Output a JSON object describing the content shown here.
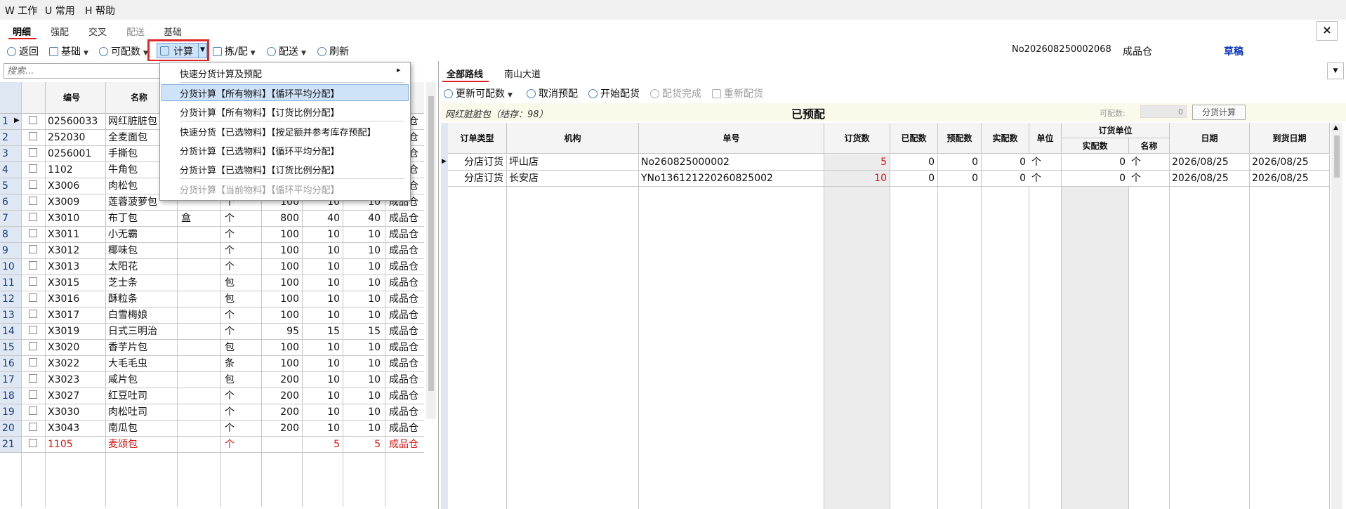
{
  "menubar": {
    "work": "W 工作",
    "common": "U 常用",
    "help": "H 帮助"
  },
  "tabs": [
    "明细",
    "强配",
    "交叉",
    "配送",
    "基础"
  ],
  "close_label": "×",
  "toolbar": {
    "back": "返回",
    "base": "基础",
    "available": "可配数",
    "calculate": "计算",
    "pick": "拣/配",
    "deliver": "配送",
    "refresh": "刷新",
    "doc_no": "No202608250002068",
    "warehouse": "成品仓",
    "status": "草稿"
  },
  "search": {
    "placeholder": "搜索..."
  },
  "left_grid": {
    "headers": {
      "code": "编号",
      "name": "名称"
    },
    "rows": [
      {
        "n": "1",
        "code": "02560033",
        "name": "网红脏脏包",
        "unit2": "",
        "unit": "",
        "a": "",
        "b": "",
        "c": "",
        "wh": "成品仓"
      },
      {
        "n": "2",
        "code": "252030",
        "name": "全麦面包",
        "unit2": "",
        "unit": "",
        "a": "",
        "b": "",
        "c": "",
        "wh": "成品仓"
      },
      {
        "n": "3",
        "code": "0256001",
        "name": "手撕包",
        "unit2": "",
        "unit": "",
        "a": "",
        "b": "",
        "c": "",
        "wh": "成品仓"
      },
      {
        "n": "4",
        "code": "1102",
        "name": "牛角包",
        "unit2": "",
        "unit": "",
        "a": "",
        "b": "",
        "c": "",
        "wh": "成品仓"
      },
      {
        "n": "5",
        "code": "X3006",
        "name": "肉松包",
        "unit2": "",
        "unit": "",
        "a": "",
        "b": "",
        "c": "",
        "wh": "成品仓"
      },
      {
        "n": "6",
        "code": "X3009",
        "name": "莲蓉菠萝包",
        "unit2": "",
        "unit": "个",
        "a": "100",
        "b": "10",
        "c": "10",
        "wh": "成品仓"
      },
      {
        "n": "7",
        "code": "X3010",
        "name": "布丁包",
        "unit2": "盒",
        "unit": "个",
        "a": "800",
        "b": "40",
        "c": "40",
        "wh": "成品仓"
      },
      {
        "n": "8",
        "code": "X3011",
        "name": "小无霸",
        "unit2": "",
        "unit": "个",
        "a": "100",
        "b": "10",
        "c": "10",
        "wh": "成品仓"
      },
      {
        "n": "9",
        "code": "X3012",
        "name": "椰味包",
        "unit2": "",
        "unit": "个",
        "a": "100",
        "b": "10",
        "c": "10",
        "wh": "成品仓"
      },
      {
        "n": "10",
        "code": "X3013",
        "name": "太阳花",
        "unit2": "",
        "unit": "个",
        "a": "100",
        "b": "10",
        "c": "10",
        "wh": "成品仓"
      },
      {
        "n": "11",
        "code": "X3015",
        "name": "芝士条",
        "unit2": "",
        "unit": "包",
        "a": "100",
        "b": "10",
        "c": "10",
        "wh": "成品仓"
      },
      {
        "n": "12",
        "code": "X3016",
        "name": "酥粒条",
        "unit2": "",
        "unit": "包",
        "a": "100",
        "b": "10",
        "c": "10",
        "wh": "成品仓"
      },
      {
        "n": "13",
        "code": "X3017",
        "name": "白雪梅娘",
        "unit2": "",
        "unit": "个",
        "a": "100",
        "b": "10",
        "c": "10",
        "wh": "成品仓"
      },
      {
        "n": "14",
        "code": "X3019",
        "name": "日式三明治",
        "unit2": "",
        "unit": "个",
        "a": "95",
        "b": "15",
        "c": "15",
        "wh": "成品仓"
      },
      {
        "n": "15",
        "code": "X3020",
        "name": "香芋片包",
        "unit2": "",
        "unit": "包",
        "a": "100",
        "b": "10",
        "c": "10",
        "wh": "成品仓"
      },
      {
        "n": "16",
        "code": "X3022",
        "name": "大毛毛虫",
        "unit2": "",
        "unit": "条",
        "a": "100",
        "b": "10",
        "c": "10",
        "wh": "成品仓"
      },
      {
        "n": "17",
        "code": "X3023",
        "name": "咸片包",
        "unit2": "",
        "unit": "包",
        "a": "200",
        "b": "10",
        "c": "10",
        "wh": "成品仓"
      },
      {
        "n": "18",
        "code": "X3027",
        "name": "红豆吐司",
        "unit2": "",
        "unit": "个",
        "a": "200",
        "b": "10",
        "c": "10",
        "wh": "成品仓"
      },
      {
        "n": "19",
        "code": "X3030",
        "name": "肉松吐司",
        "unit2": "",
        "unit": "个",
        "a": "200",
        "b": "10",
        "c": "10",
        "wh": "成品仓"
      },
      {
        "n": "20",
        "code": "X3043",
        "name": "南瓜包",
        "unit2": "",
        "unit": "个",
        "a": "200",
        "b": "10",
        "c": "10",
        "wh": "成品仓"
      },
      {
        "n": "21",
        "code": "1105",
        "name": "麦颂包",
        "unit2": "",
        "unit": "个",
        "a": "",
        "b": "5",
        "c": "5",
        "wh": "成品仓",
        "red": true
      }
    ]
  },
  "dropdown": {
    "items": [
      "快速分货计算及预配",
      "分货计算【所有物料】【循环平均分配】",
      "分货计算【所有物料】【订货比例分配】",
      "快速分货【已选物料】【按足额并参考库存预配】",
      "分货计算【已选物料】【循环平均分配】",
      "分货计算【已选物料】【订货比例分配】",
      "分货计算【当前物料】【循环平均分配】"
    ]
  },
  "right": {
    "tabs": [
      "全部路线",
      "南山大道"
    ],
    "toolbar": {
      "update": "更新可配数",
      "cancel": "取消预配",
      "start": "开始配货",
      "done": "配货完成",
      "redo": "重新配货"
    },
    "item_title": "网红脏脏包（结存：98）",
    "state": "已预配",
    "avail_label": "可配数:",
    "avail_value": "0",
    "calc_button": "分货计算",
    "headers": {
      "order_type": "订单类型",
      "org": "机构",
      "doc": "单号",
      "order_qty": "订货数",
      "allocated": "已配数",
      "pre": "预配数",
      "actual": "实配数",
      "unit": "单位",
      "order_unit": "订货单位",
      "ou_actual": "实配数",
      "ou_name": "名称",
      "date": "日期",
      "arrive": "到货日期"
    },
    "rows": [
      {
        "type": "分店订货",
        "org": "坪山店",
        "doc": "No260825000002",
        "qty": "5",
        "allocated": "0",
        "pre": "0",
        "actual": "0",
        "unit": "个",
        "ou_actual": "0",
        "ou_name": "个",
        "date": "2026/08/25",
        "arrive": "2026/08/25"
      },
      {
        "type": "分店订货",
        "org": "长安店",
        "doc": "YNo136121220260825002",
        "qty": "10",
        "allocated": "0",
        "pre": "0",
        "actual": "0",
        "unit": "个",
        "ou_actual": "0",
        "ou_name": "个",
        "date": "2026/08/25",
        "arrive": "2026/08/25"
      }
    ]
  }
}
